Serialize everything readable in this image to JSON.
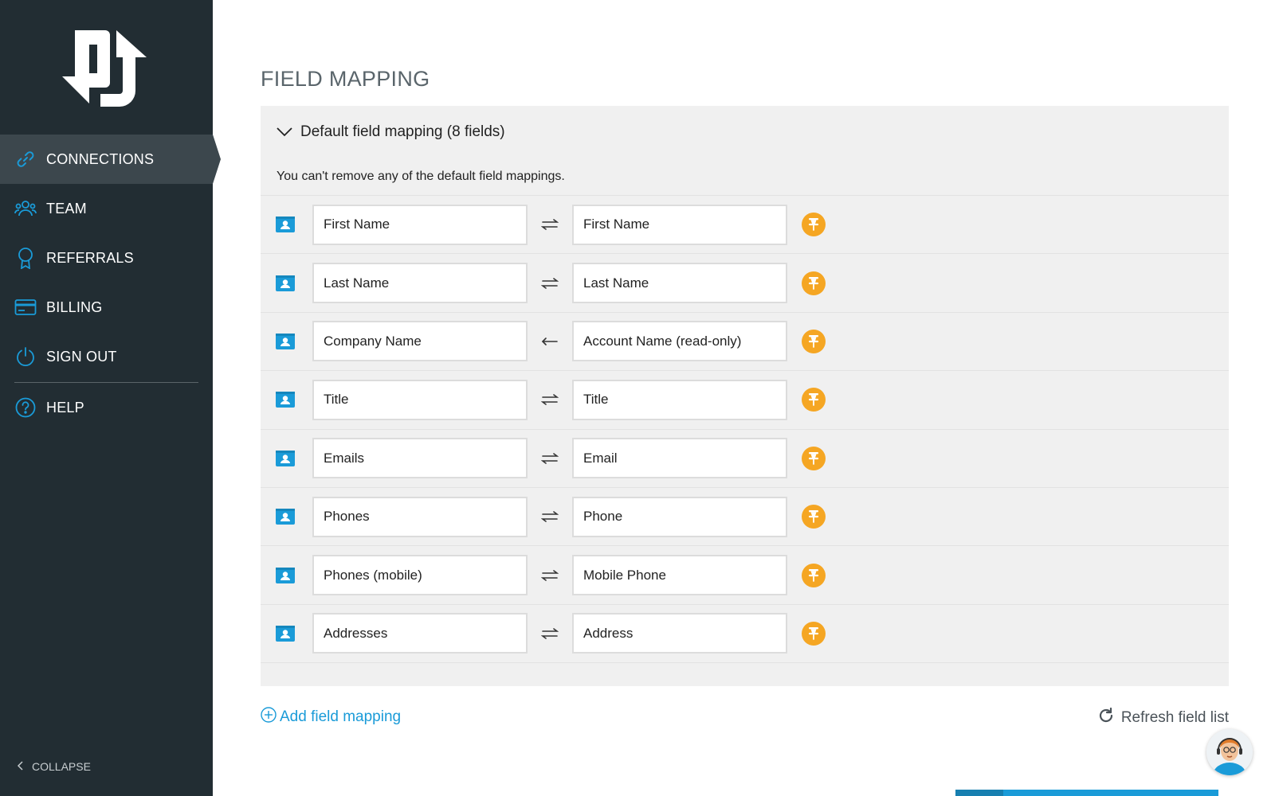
{
  "sidebar": {
    "nav": [
      {
        "label": "CONNECTIONS",
        "icon": "link-icon",
        "active": true
      },
      {
        "label": "TEAM",
        "icon": "team-icon",
        "active": false
      },
      {
        "label": "REFERRALS",
        "icon": "ribbon-icon",
        "active": false
      },
      {
        "label": "BILLING",
        "icon": "credit-card-icon",
        "active": false
      },
      {
        "label": "SIGN OUT",
        "icon": "power-icon",
        "active": false
      },
      {
        "label": "HELP",
        "icon": "help-icon",
        "active": false
      }
    ],
    "collapse_label": "COLLAPSE"
  },
  "main": {
    "title": "FIELD MAPPING",
    "panel": {
      "header": "Default field mapping (8 fields)",
      "note": "You can't remove any of the default field mappings.",
      "rows": [
        {
          "left": "First Name",
          "direction": "both",
          "right": "First Name"
        },
        {
          "left": "Last Name",
          "direction": "both",
          "right": "Last Name"
        },
        {
          "left": "Company Name",
          "direction": "left",
          "right": "Account Name (read-only)"
        },
        {
          "left": "Title",
          "direction": "both",
          "right": "Title"
        },
        {
          "left": "Emails",
          "direction": "both",
          "right": "Email"
        },
        {
          "left": "Phones",
          "direction": "both",
          "right": "Phone"
        },
        {
          "left": "Phones (mobile)",
          "direction": "both",
          "right": "Mobile Phone"
        },
        {
          "left": "Addresses",
          "direction": "both",
          "right": "Address"
        }
      ]
    },
    "add_mapping_label": "Add field mapping",
    "refresh_label": "Refresh field list"
  },
  "colors": {
    "sidebar_bg": "#222d33",
    "accent_blue": "#1a9bd8",
    "pin_orange": "#f5a623"
  }
}
